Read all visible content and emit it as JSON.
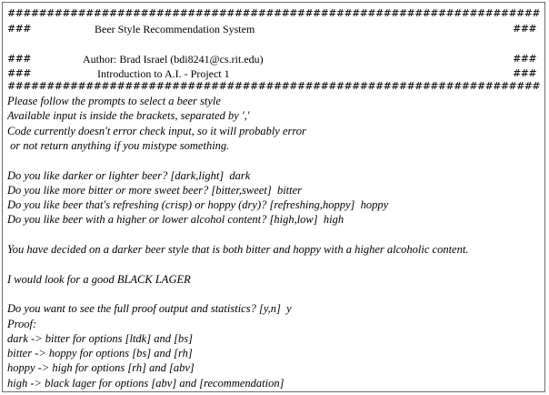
{
  "header": {
    "hash_line": "####################################################################################################",
    "row_prefix": "###",
    "row_suffix": "###",
    "title": "Beer Style Recommendation System",
    "author": "Author: Brad Israel (bdi8241@cs.rit.edu)",
    "course": "Introduction to A.I. - Project 1"
  },
  "console_lines": [
    "Please follow the prompts to select a beer style",
    "Available input is inside the brackets, separated by ','",
    "Code currently doesn't error check input, so it will probably error",
    " or not return anything if you mistype something.",
    "",
    "Do you like darker or lighter beer? [dark,light]  dark",
    "Do you like more bitter or more sweet beer? [bitter,sweet]  bitter",
    "Do you like beer that's refreshing (crisp) or hoppy (dry)? [refreshing,hoppy]  hoppy",
    "Do you like beer with a higher or lower alcohol content? [high,low]  high",
    "",
    "You have decided on a darker beer style that is both bitter and hoppy with a higher alcoholic content.",
    "",
    "I would look for a good BLACK LAGER",
    "",
    "Do you want to see the full proof output and statistics? [y,n]  y",
    "Proof:",
    "dark -> bitter for options [ltdk] and [bs]",
    "bitter -> hoppy for options [bs] and [rh]",
    "hoppy -> high for options [rh] and [abv]",
    "high -> black lager for options [abv] and [recommendation]"
  ]
}
